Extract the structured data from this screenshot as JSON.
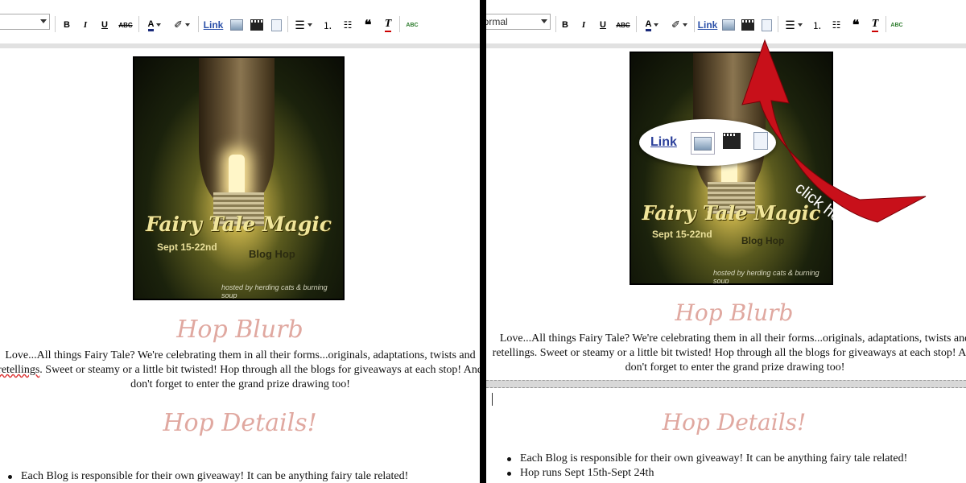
{
  "toolbar": {
    "font_select_value": "Normal",
    "bold": "B",
    "italic": "I",
    "underline": "U",
    "strike": "ABC",
    "text_color": "A",
    "link": "Link",
    "quote": "❝",
    "clear_format": "T",
    "spellcheck": "ABC"
  },
  "post": {
    "cover": {
      "title": "Fairy Tale Magic",
      "dates": "Sept 15-22nd",
      "subtitle": "Blog Hop",
      "hosted": "hosted by herding cats & burning soup"
    },
    "blurb_heading": "Hop Blurb",
    "blurb_text": "Love...All things Fairy Tale? We're celebrating them in all their forms...originals, adaptations, twists and retellings. Sweet or steamy or a little bit twisted! Hop through all the blogs for giveaways at each stop! And don't forget to enter the grand prize drawing too!",
    "blurb_left": {
      "line1": "Love...All things Fairy Tale? We're celebrating them in all their forms...originals, adaptations, twists and",
      "line2_spell": "retellings",
      "line2_rest": ". Sweet or steamy or a little bit twisted! Hop through all the blogs for giveaways at each stop! And",
      "line3": "don't forget to enter the grand prize drawing too!"
    },
    "details_heading": "Hop Details!",
    "details_items": [
      "Each Blog is responsible for their own giveaway! It can be anything fairy tale related!",
      "Hop runs Sept 15th-Sept 24th"
    ]
  },
  "callout": {
    "link": "Link",
    "instruction": "click here"
  },
  "colors": {
    "heading": "#e0a8a0",
    "arrow": "#c8101a",
    "link": "#2a4fa8"
  },
  "icons": [
    "bold-icon",
    "italic-icon",
    "underline-icon",
    "strikethrough-icon",
    "text-color-icon",
    "highlight-icon",
    "insert-image-icon",
    "insert-video-icon",
    "insert-jump-break-icon",
    "align-icon",
    "numbered-list-icon",
    "bullet-list-icon",
    "quote-icon",
    "remove-formatting-icon",
    "spellcheck-icon"
  ]
}
